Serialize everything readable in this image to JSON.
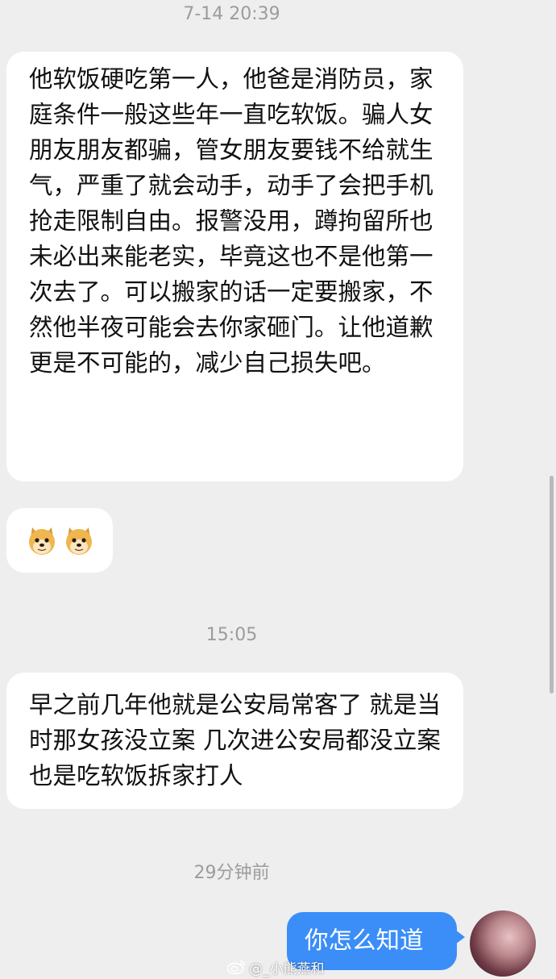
{
  "timestamps": {
    "first": "7-14 20:39",
    "second": "15:05",
    "third": "29分钟前"
  },
  "messages": {
    "incoming_1": "他软饭硬吃第一人，他爸是消防员，家庭条件一般这些年一直吃软饭。骗人女朋友朋友都骗，管女朋友要钱不给就生气，严重了就会动手，动手了会把手机抢走限制自由。报警没用，蹲拘留所也未必出来能老实，毕竟这也不是他第一次去了。可以搬家的话一定要搬家，不然他半夜可能会去你家砸门。让他道歉更是不可能的，减少自己损失吧。",
    "incoming_2_emojis": [
      "doge-emoji",
      "doge-emoji"
    ],
    "incoming_3": "早之前几年他就是公安局常客了 就是当时那女孩没立案 几次进公安局都没立案 也是吃软饭拆家打人",
    "outgoing_1": "你怎么知道"
  },
  "watermark": {
    "handle": "@_小熊燕和"
  },
  "colors": {
    "background": "#eeeeef",
    "incoming_bubble": "#ffffff",
    "outgoing_bubble": "#3b8ef8",
    "timestamp_text": "#9c9c9f"
  },
  "icons": {
    "watermark": "weibo-logo-icon",
    "emoji": "doge-emoji"
  }
}
